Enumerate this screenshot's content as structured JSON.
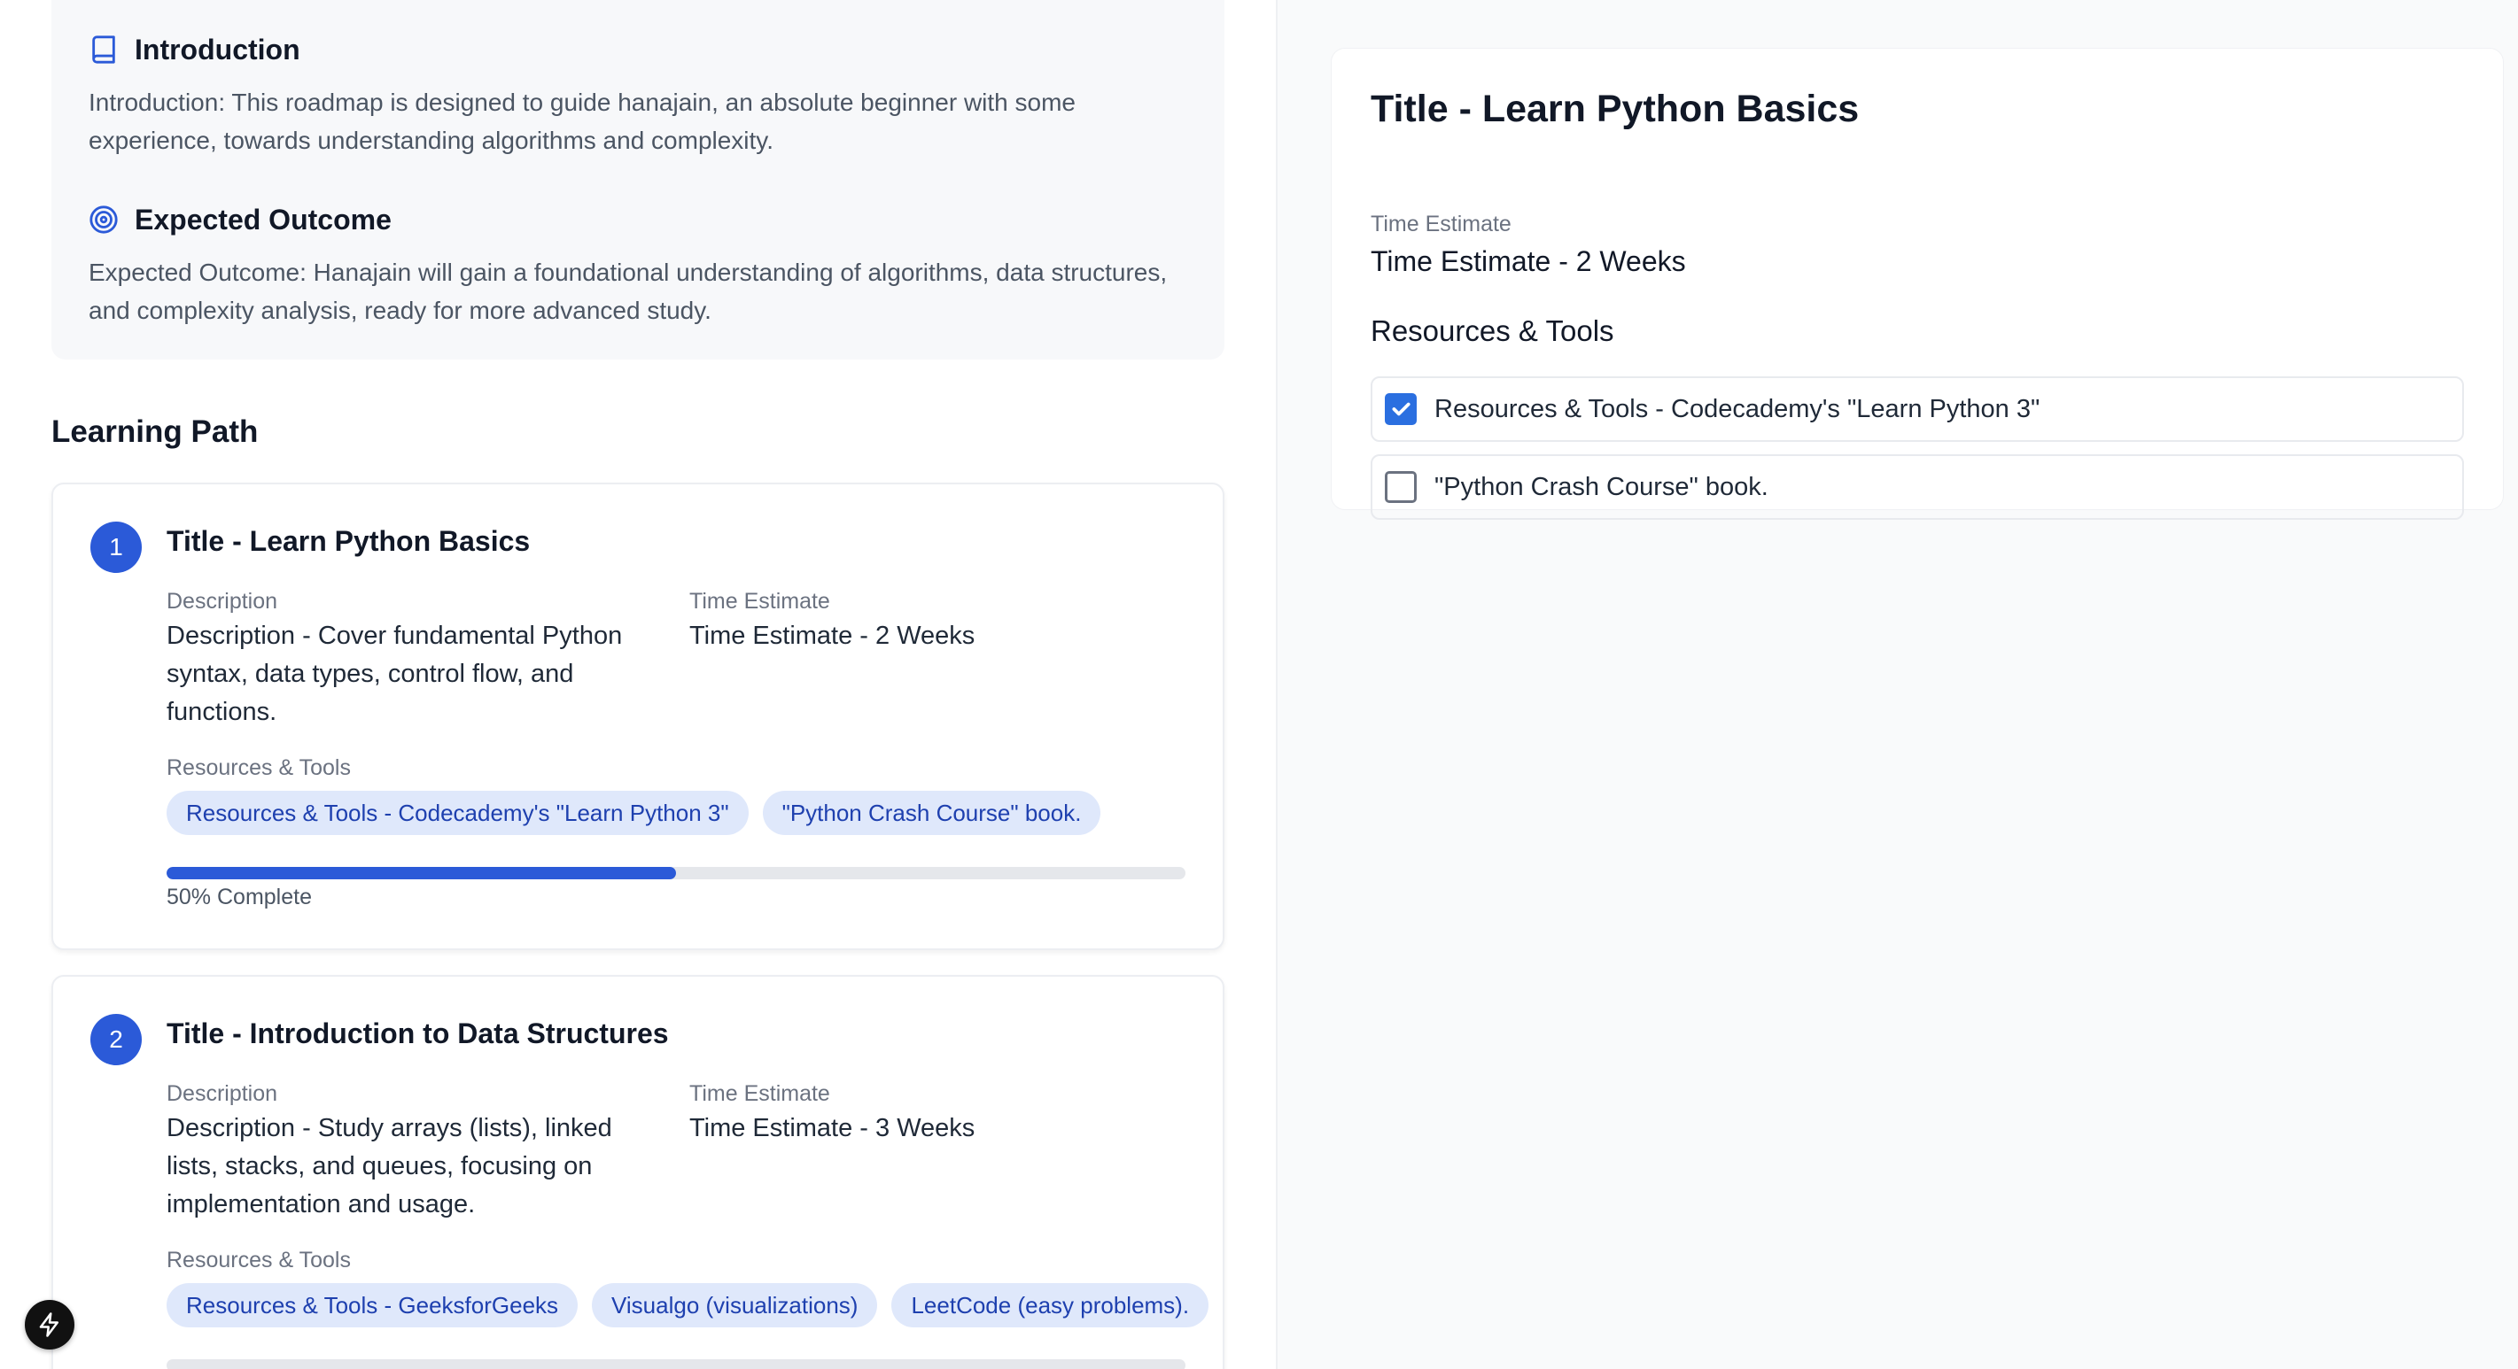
{
  "overview": {
    "introduction_heading": "Introduction",
    "introduction_text": "Introduction: This roadmap is designed to guide hanajain, an absolute beginner with some experience, towards understanding algorithms and complexity.",
    "outcome_heading": "Expected Outcome",
    "outcome_text": "Expected Outcome: Hanajain will gain a foundational understanding of algorithms, data structures, and complexity analysis, ready for more advanced study."
  },
  "learning_path": {
    "heading": "Learning Path",
    "description_label": "Description",
    "time_label": "Time Estimate",
    "resources_label": "Resources & Tools",
    "steps": [
      {
        "number": "1",
        "title": "Title - Learn Python Basics",
        "description": "Description - Cover fundamental Python syntax, data types, control flow, and functions.",
        "time": "Time Estimate - 2 Weeks",
        "resources": [
          "Resources & Tools - Codecademy's \"Learn Python 3\"",
          "\"Python Crash Course\" book."
        ],
        "progress": 0.5,
        "progress_text": "50% Complete"
      },
      {
        "number": "2",
        "title": "Title - Introduction to Data Structures",
        "description": "Description - Study arrays (lists), linked lists, stacks, and queues, focusing on implementation and usage.",
        "time": "Time Estimate - 3 Weeks",
        "resources": [
          "Resources & Tools - GeeksforGeeks",
          "Visualgo (visualizations)",
          "LeetCode (easy problems)."
        ],
        "progress": 0
      }
    ]
  },
  "detail": {
    "title": "Title - Learn Python Basics",
    "time_label": "Time Estimate",
    "time_value": "Time Estimate - 2 Weeks",
    "resources_heading": "Resources & Tools",
    "checklist": [
      {
        "label": "Resources & Tools - Codecademy's \"Learn Python 3\"",
        "checked": true
      },
      {
        "label": "\"Python Crash Course\" book.",
        "checked": false
      }
    ]
  },
  "icons": {
    "introduction": "book-icon",
    "outcome": "target-icon",
    "fab": "lightning-icon"
  },
  "colors": {
    "accent": "#2b5ad8",
    "chip_bg": "#dfe8fb",
    "chip_text": "#1e40af"
  }
}
